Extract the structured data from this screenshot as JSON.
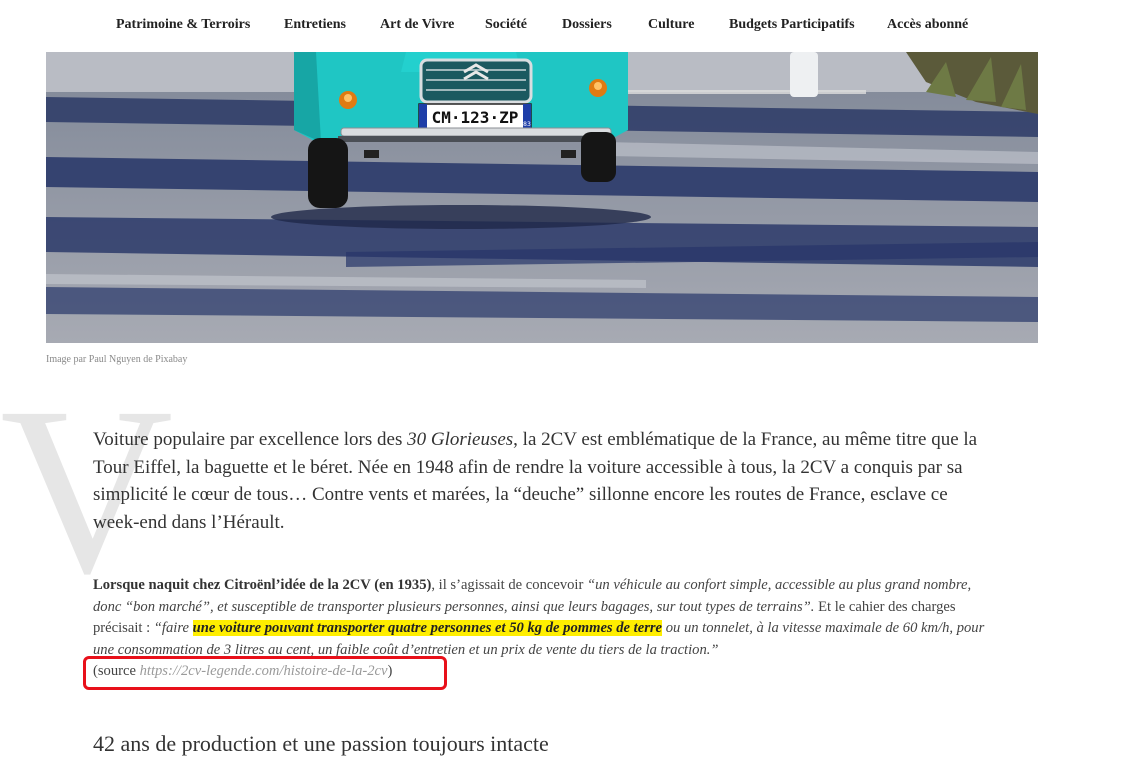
{
  "nav": {
    "items": [
      "Patrimoine & Terroirs",
      "Entretiens",
      "Art de Vivre",
      "Société",
      "Dossiers",
      "Culture",
      "Budgets Participatifs",
      "Accès abonné"
    ]
  },
  "hero": {
    "plate": "CM·123·ZP",
    "plate_dept": "83"
  },
  "caption": "Image par Paul Nguyen de Pixabay",
  "dropcap": "V",
  "lead": {
    "p1": "Voiture populaire par excellence lors des ",
    "em1": "30 Glorieuses",
    "p2": ", la 2CV est emblématique de la France, au même titre que la Tour Eiffel, la baguette et le béret. Née en 1948 afin de rendre la voiture accessible à tous, la 2CV a conquis par sa simplicité le cœur de tous… Contre vents et marées, la “deuche” sillonne encore les routes de France, esclave ce week-end dans l’Hérault."
  },
  "quote": {
    "strong": "Lorsque naquit chez Citroënl’idée de la 2CV (en 1935)",
    "t1": ", il s’agissait de concevoir ",
    "em1": "“un véhicule au confort simple, accessible au plus grand nombre, donc “bon marché”, et susceptible de transporter plusieurs personnes, ainsi que leurs bagages, sur tout types de terrains”.",
    "t2": " Et le cahier des charges précisait : ",
    "em2": "“faire ",
    "highlight": "une voiture pouvant transporter quatre personnes et 50 kg de pommes de terre",
    "em3": " ou un tonnelet, à la vitesse maximale de 60 km/h, pour une consommation de 3 litres au cent, un faible coût d’entretien et un prix de vente du tiers de la traction.”",
    "source_open": "(source ",
    "source_link": "https://2cv-legende.com/histoire-de-la-2cv",
    "source_close": ")"
  },
  "heading2": "42 ans de production et une passion toujours intacte",
  "colors": {
    "highlight": "#ffee00",
    "annotation": "#e8101a",
    "car_body": "#1fc6c4"
  }
}
